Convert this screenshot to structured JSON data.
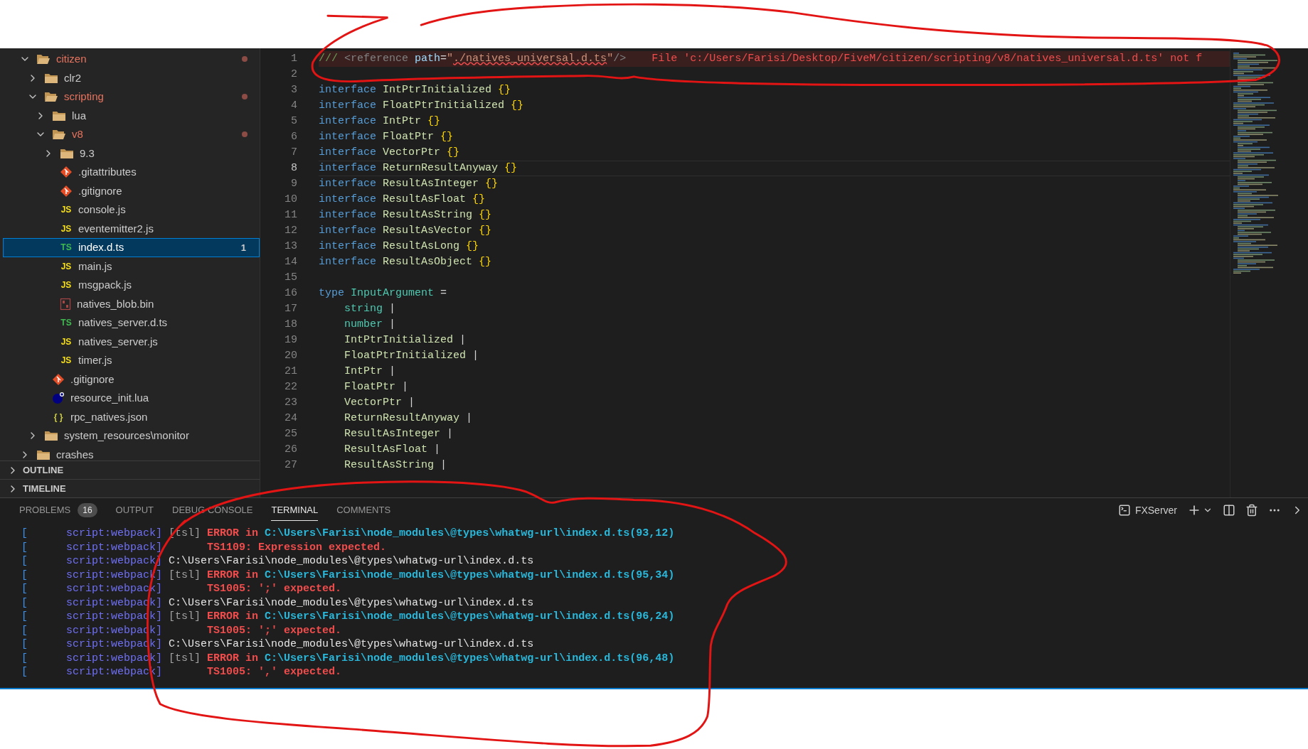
{
  "explorer": {
    "items": [
      {
        "name": "citizen",
        "kind": "folder",
        "expanded": true,
        "modified": true,
        "selected": false,
        "children": [
          {
            "name": "clr2",
            "kind": "folder",
            "expanded": false,
            "modified": false,
            "selected": false
          },
          {
            "name": "scripting",
            "kind": "folder",
            "expanded": true,
            "modified": true,
            "selected": false,
            "children": [
              {
                "name": "lua",
                "kind": "folder",
                "expanded": false,
                "modified": false,
                "selected": false
              },
              {
                "name": "v8",
                "kind": "folder",
                "expanded": true,
                "modified": true,
                "selected": false,
                "children": [
                  {
                    "name": "9.3",
                    "kind": "folder",
                    "expanded": false,
                    "modified": false,
                    "selected": false
                  },
                  {
                    "name": ".gitattributes",
                    "kind": "git",
                    "modified": false,
                    "selected": false
                  },
                  {
                    "name": ".gitignore",
                    "kind": "git",
                    "modified": false,
                    "selected": false
                  },
                  {
                    "name": "console.js",
                    "kind": "js",
                    "icon_text": "JS",
                    "modified": false,
                    "selected": false
                  },
                  {
                    "name": "eventemitter2.js",
                    "kind": "js",
                    "icon_text": "JS",
                    "modified": false,
                    "selected": false
                  },
                  {
                    "name": "index.d.ts",
                    "kind": "ts",
                    "icon_text": "TS",
                    "modified": false,
                    "selected": true,
                    "badge": "1"
                  },
                  {
                    "name": "main.js",
                    "kind": "js",
                    "icon_text": "JS",
                    "modified": false,
                    "selected": false
                  },
                  {
                    "name": "msgpack.js",
                    "kind": "js",
                    "icon_text": "JS",
                    "modified": false,
                    "selected": false
                  },
                  {
                    "name": "natives_blob.bin",
                    "kind": "bin",
                    "modified": false,
                    "selected": false
                  },
                  {
                    "name": "natives_server.d.ts",
                    "kind": "ts",
                    "icon_text": "TS",
                    "modified": false,
                    "selected": false
                  },
                  {
                    "name": "natives_server.js",
                    "kind": "js",
                    "icon_text": "JS",
                    "modified": false,
                    "selected": false
                  },
                  {
                    "name": "timer.js",
                    "kind": "js",
                    "icon_text": "JS",
                    "modified": false,
                    "selected": false
                  }
                ]
              },
              {
                "name": ".gitignore",
                "kind": "git",
                "modified": false,
                "selected": false
              },
              {
                "name": "resource_init.lua",
                "kind": "lua",
                "modified": false,
                "selected": false
              },
              {
                "name": "rpc_natives.json",
                "kind": "json",
                "icon_text": "{ }",
                "modified": false,
                "selected": false
              }
            ]
          },
          {
            "name": "system_resources\\monitor",
            "kind": "folder",
            "expanded": false,
            "modified": false,
            "selected": false
          }
        ]
      },
      {
        "name": "crashes",
        "kind": "folder",
        "expanded": false,
        "modified": false,
        "selected": false
      }
    ]
  },
  "sections": [
    {
      "label": "OUTLINE",
      "expanded": false
    },
    {
      "label": "TIMELINE",
      "expanded": false
    }
  ],
  "editor": {
    "lines": [
      {
        "number": "1",
        "selected": false,
        "tokens": [
          {
            "text": "/// ",
            "kind": "comment"
          },
          {
            "text": "<reference",
            "kind": "tag"
          },
          {
            "text": " path",
            "kind": "attr"
          },
          {
            "text": "=",
            "kind": "plain"
          },
          {
            "text": "\"",
            "kind": "string"
          },
          {
            "text": "./natives_universal.d.ts",
            "kind": "string",
            "squiggle": true
          },
          {
            "text": "\"",
            "kind": "string"
          },
          {
            "text": "/>",
            "kind": "tag"
          }
        ],
        "error_message": "File 'c:/Users/Farisi/Desktop/FiveM/citizen/scripting/v8/natives_universal.d.ts' not f"
      },
      {
        "number": "2",
        "selected": false
      },
      {
        "number": "3",
        "selected": false,
        "tokens": [
          {
            "text": "interface",
            "kind": "keyword"
          },
          {
            "text": " IntPtrInitialized ",
            "kind": "name"
          },
          {
            "text": "{}",
            "kind": "brace"
          }
        ]
      },
      {
        "number": "4",
        "selected": false,
        "tokens": [
          {
            "text": "interface",
            "kind": "keyword"
          },
          {
            "text": " FloatPtrInitialized ",
            "kind": "name"
          },
          {
            "text": "{}",
            "kind": "brace"
          }
        ]
      },
      {
        "number": "5",
        "selected": false,
        "tokens": [
          {
            "text": "interface",
            "kind": "keyword"
          },
          {
            "text": " IntPtr ",
            "kind": "name"
          },
          {
            "text": "{}",
            "kind": "brace"
          }
        ]
      },
      {
        "number": "6",
        "selected": false,
        "tokens": [
          {
            "text": "interface",
            "kind": "keyword"
          },
          {
            "text": " FloatPtr ",
            "kind": "name"
          },
          {
            "text": "{}",
            "kind": "brace"
          }
        ]
      },
      {
        "number": "7",
        "selected": false,
        "tokens": [
          {
            "text": "interface",
            "kind": "keyword"
          },
          {
            "text": " VectorPtr ",
            "kind": "name"
          },
          {
            "text": "{}",
            "kind": "brace"
          }
        ]
      },
      {
        "number": "8",
        "selected": true,
        "tokens": [
          {
            "text": "interface",
            "kind": "keyword"
          },
          {
            "text": " ReturnResultAnyway ",
            "kind": "name"
          },
          {
            "text": "{}",
            "kind": "brace"
          }
        ]
      },
      {
        "number": "9",
        "selected": false,
        "tokens": [
          {
            "text": "interface",
            "kind": "keyword"
          },
          {
            "text": " ResultAsInteger ",
            "kind": "name"
          },
          {
            "text": "{}",
            "kind": "brace"
          }
        ]
      },
      {
        "number": "10",
        "selected": false,
        "tokens": [
          {
            "text": "interface",
            "kind": "keyword"
          },
          {
            "text": " ResultAsFloat ",
            "kind": "name"
          },
          {
            "text": "{}",
            "kind": "brace"
          }
        ]
      },
      {
        "number": "11",
        "selected": false,
        "tokens": [
          {
            "text": "interface",
            "kind": "keyword"
          },
          {
            "text": " ResultAsString ",
            "kind": "name"
          },
          {
            "text": "{}",
            "kind": "brace"
          }
        ]
      },
      {
        "number": "12",
        "selected": false,
        "tokens": [
          {
            "text": "interface",
            "kind": "keyword"
          },
          {
            "text": " ResultAsVector ",
            "kind": "name"
          },
          {
            "text": "{}",
            "kind": "brace"
          }
        ]
      },
      {
        "number": "13",
        "selected": false,
        "tokens": [
          {
            "text": "interface",
            "kind": "keyword"
          },
          {
            "text": " ResultAsLong ",
            "kind": "name"
          },
          {
            "text": "{}",
            "kind": "brace"
          }
        ]
      },
      {
        "number": "14",
        "selected": false,
        "tokens": [
          {
            "text": "interface",
            "kind": "keyword"
          },
          {
            "text": " ResultAsObject ",
            "kind": "name"
          },
          {
            "text": "{}",
            "kind": "brace"
          }
        ]
      },
      {
        "number": "15",
        "selected": false
      },
      {
        "number": "16",
        "selected": false,
        "tokens": [
          {
            "text": "type ",
            "kind": "keyword"
          },
          {
            "text": "InputArgument",
            "kind": "typename"
          },
          {
            "text": " =",
            "kind": "plain"
          }
        ]
      },
      {
        "number": "17",
        "selected": false,
        "tokens": [
          {
            "text": "    string",
            "kind": "typename"
          },
          {
            "text": " |",
            "kind": "plain"
          }
        ]
      },
      {
        "number": "18",
        "selected": false,
        "tokens": [
          {
            "text": "    number",
            "kind": "typename"
          },
          {
            "text": " |",
            "kind": "plain"
          }
        ]
      },
      {
        "number": "19",
        "selected": false,
        "tokens": [
          {
            "text": "    IntPtrInitialized",
            "kind": "name"
          },
          {
            "text": " |",
            "kind": "plain"
          }
        ]
      },
      {
        "number": "20",
        "selected": false,
        "tokens": [
          {
            "text": "    FloatPtrInitialized",
            "kind": "name"
          },
          {
            "text": " |",
            "kind": "plain"
          }
        ]
      },
      {
        "number": "21",
        "selected": false,
        "tokens": [
          {
            "text": "    IntPtr",
            "kind": "name"
          },
          {
            "text": " |",
            "kind": "plain"
          }
        ]
      },
      {
        "number": "22",
        "selected": false,
        "tokens": [
          {
            "text": "    FloatPtr",
            "kind": "name"
          },
          {
            "text": " |",
            "kind": "plain"
          }
        ]
      },
      {
        "number": "23",
        "selected": false,
        "tokens": [
          {
            "text": "    VectorPtr",
            "kind": "name"
          },
          {
            "text": " |",
            "kind": "plain"
          }
        ]
      },
      {
        "number": "24",
        "selected": false,
        "tokens": [
          {
            "text": "    ReturnResultAnyway",
            "kind": "name"
          },
          {
            "text": " |",
            "kind": "plain"
          }
        ]
      },
      {
        "number": "25",
        "selected": false,
        "tokens": [
          {
            "text": "    ResultAsInteger",
            "kind": "name"
          },
          {
            "text": " |",
            "kind": "plain"
          }
        ]
      },
      {
        "number": "26",
        "selected": false,
        "tokens": [
          {
            "text": "    ResultAsFloat",
            "kind": "name"
          },
          {
            "text": " |",
            "kind": "plain"
          }
        ]
      },
      {
        "number": "27",
        "selected": false,
        "tokens": [
          {
            "text": "    ResultAsString",
            "kind": "name"
          },
          {
            "text": " |",
            "kind": "plain"
          }
        ]
      }
    ]
  },
  "panel": {
    "tabs": [
      {
        "label": "PROBLEMS",
        "badge": "16",
        "selected": false
      },
      {
        "label": "OUTPUT",
        "selected": false
      },
      {
        "label": "DEBUG CONSOLE",
        "selected": false
      },
      {
        "label": "TERMINAL",
        "selected": true
      },
      {
        "label": "COMMENTS",
        "selected": false
      }
    ],
    "terminal_name": "FXServer",
    "lines": [
      [
        {
          "text": "[",
          "kind": "bracket"
        },
        {
          "text": "      script:webpack]",
          "kind": "source"
        },
        {
          "text": " [tsl] ",
          "kind": "tag"
        },
        {
          "text": "ERROR in ",
          "kind": "error"
        },
        {
          "text": "C:\\Users\\Farisi\\node_modules\\@types\\whatwg-url\\index.d.ts(93,12)",
          "kind": "path"
        }
      ],
      [
        {
          "text": "[",
          "kind": "bracket"
        },
        {
          "text": "      script:webpack]",
          "kind": "source"
        },
        {
          "text": "       TS1109: Expression expected.",
          "kind": "error"
        }
      ],
      [
        {
          "text": "[",
          "kind": "bracket"
        },
        {
          "text": "      script:webpack]",
          "kind": "source"
        },
        {
          "text": " C:\\Users\\Farisi\\node_modules\\@types\\whatwg-url\\index.d.ts",
          "kind": "plain"
        }
      ],
      [
        {
          "text": "[",
          "kind": "bracket"
        },
        {
          "text": "      script:webpack]",
          "kind": "source"
        },
        {
          "text": " [tsl] ",
          "kind": "tag"
        },
        {
          "text": "ERROR in ",
          "kind": "error"
        },
        {
          "text": "C:\\Users\\Farisi\\node_modules\\@types\\whatwg-url\\index.d.ts(95,34)",
          "kind": "path"
        }
      ],
      [
        {
          "text": "[",
          "kind": "bracket"
        },
        {
          "text": "      script:webpack]",
          "kind": "source"
        },
        {
          "text": "       TS1005: ';' expected.",
          "kind": "error"
        }
      ],
      [
        {
          "text": "[",
          "kind": "bracket"
        },
        {
          "text": "      script:webpack]",
          "kind": "source"
        },
        {
          "text": " C:\\Users\\Farisi\\node_modules\\@types\\whatwg-url\\index.d.ts",
          "kind": "plain"
        }
      ],
      [
        {
          "text": "[",
          "kind": "bracket"
        },
        {
          "text": "      script:webpack]",
          "kind": "source"
        },
        {
          "text": " [tsl] ",
          "kind": "tag"
        },
        {
          "text": "ERROR in ",
          "kind": "error"
        },
        {
          "text": "C:\\Users\\Farisi\\node_modules\\@types\\whatwg-url\\index.d.ts(96,24)",
          "kind": "path"
        }
      ],
      [
        {
          "text": "[",
          "kind": "bracket"
        },
        {
          "text": "      script:webpack]",
          "kind": "source"
        },
        {
          "text": "       TS1005: ';' expected.",
          "kind": "error"
        }
      ],
      [
        {
          "text": "[",
          "kind": "bracket"
        },
        {
          "text": "      script:webpack]",
          "kind": "source"
        },
        {
          "text": " C:\\Users\\Farisi\\node_modules\\@types\\whatwg-url\\index.d.ts",
          "kind": "plain"
        }
      ],
      [
        {
          "text": "[",
          "kind": "bracket"
        },
        {
          "text": "      script:webpack]",
          "kind": "source"
        },
        {
          "text": " [tsl] ",
          "kind": "tag"
        },
        {
          "text": "ERROR in ",
          "kind": "error"
        },
        {
          "text": "C:\\Users\\Farisi\\node_modules\\@types\\whatwg-url\\index.d.ts(96,48)",
          "kind": "path"
        }
      ],
      [
        {
          "text": "[",
          "kind": "bracket"
        },
        {
          "text": "      script:webpack]",
          "kind": "source"
        },
        {
          "text": "       TS1005: ',' expected.",
          "kind": "error"
        }
      ]
    ]
  }
}
